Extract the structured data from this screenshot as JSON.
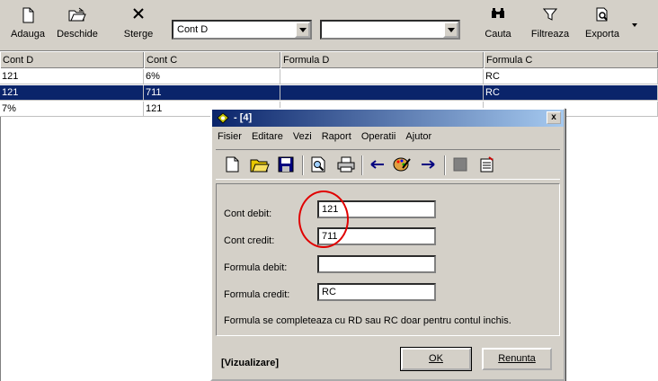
{
  "toolbar": {
    "add_label": "Adauga",
    "open_label": "Deschide",
    "delete_label": "Sterge",
    "combo1_value": "Cont D",
    "combo2_value": "",
    "search_label": "Cauta",
    "filter_label": "Filtreaza",
    "export_label": "Exporta"
  },
  "grid": {
    "columns": [
      "Cont D",
      "Cont C",
      "Formula D",
      "Formula C"
    ],
    "rows": [
      [
        "121",
        "6%",
        "",
        "RC"
      ],
      [
        "121",
        "711",
        "",
        "RC"
      ],
      [
        "7%",
        "121",
        "",
        ""
      ]
    ],
    "selected_row": 1
  },
  "dialog": {
    "title": "- [4]",
    "close_label": "x",
    "menu": [
      "Fisier",
      "Editare",
      "Vezi",
      "Raport",
      "Operatii",
      "Ajutor"
    ],
    "fields": [
      {
        "label": "Cont debit:",
        "value": "121"
      },
      {
        "label": "Cont credit:",
        "value": "711"
      },
      {
        "label": "Formula debit:",
        "value": ""
      },
      {
        "label": "Formula credit:",
        "value": "RC"
      }
    ],
    "note": "Formula se completeaza cu RD sau RC doar pentru contul inchis.",
    "status": "[Vizualizare]",
    "ok_label": "OK",
    "cancel_label": "Renunta"
  },
  "colors": {
    "selection": "#0a246a",
    "face": "#d4d0c8",
    "annotation": "#e00000"
  }
}
